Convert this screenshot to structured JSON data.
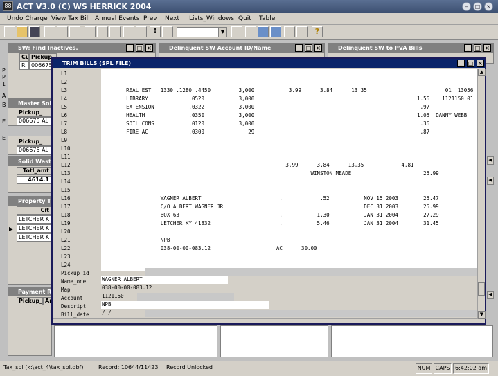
{
  "app": {
    "title": "ACT V3.0 (C) WS HERRICK 2004",
    "icon_label": "88"
  },
  "menu": [
    "Undo Charge",
    "View Tax Bill",
    "Annual Events",
    "Prev",
    "Next",
    "Lists_Windows",
    "Quit",
    "Table"
  ],
  "toolbar": {
    "icons": [
      "new-icon",
      "open-icon",
      "save-icon",
      "print-icon",
      "preview-icon",
      "spellcheck-icon",
      "cut-icon",
      "copy-icon",
      "paste-icon",
      "undo-icon",
      "redo-icon",
      "exclaim-icon",
      "edit-icon",
      "combo",
      "form-icon",
      "browse-icon",
      "locate-icon",
      "find-icon",
      "report-icon",
      "label-icon",
      "help-icon"
    ],
    "help_label": "?"
  },
  "bg_windows": {
    "find_inactives": {
      "title": "SW: Find Inactives.",
      "cols": [
        "Cu",
        "Pickup_"
      ],
      "row": [
        "R",
        "006675"
      ]
    },
    "delinq_sw": {
      "title": "Delinquent SW Account ID/Name"
    },
    "delinq_pva": {
      "title": "Delinquent SW to PVA Bills"
    },
    "master_sol": {
      "title": "Master Soli",
      "col": "Pickup_",
      "row": "006675 AL"
    },
    "extra": {
      "col": "Pickup_",
      "row": "006675 AL"
    },
    "solid_waste": {
      "title": "Solid Waste",
      "col": "Totl_amt",
      "row": "4614.1"
    },
    "property_tax": {
      "title": "Property Ta",
      "col": "Cit",
      "rows": [
        "LETCHER K",
        "LETCHER K",
        "LETCHER K"
      ]
    },
    "payment": {
      "title": "Payment Re",
      "col": "Pickup_id",
      "col2": "Ar"
    }
  },
  "left_markers": [
    "P",
    "P",
    "1",
    "A",
    "B",
    "E",
    "E"
  ],
  "trim": {
    "title": "TRIM BILLS (SPL FILE)",
    "line_labels": [
      "L1",
      "L2",
      "L3",
      "L4",
      "L5",
      "L6",
      "L7",
      "L8",
      "L9",
      "L10",
      "L11",
      "L12",
      "L13",
      "L14",
      "L15",
      "L16",
      "L17",
      "L18",
      "L19",
      "L20",
      "L21",
      "L22",
      "L23",
      "L24"
    ],
    "lines": [
      "",
      "",
      "        REAL EST  .1330 .1280 .4450         3,000           3.99      3.84      13.35                         01  13056",
      "        LIBRARY             .0520           3,000                                                    1.56    1121150 01",
      "        EXTENSION           .0322           3,000                                                     .97",
      "        HEALTH              .0350           3,000                                                    1.05  DANNY WEBB",
      "        SOIL CONS           .0120           3,000                                                     .36",
      "        FIRE AC             .0300              29                                                     .87",
      "",
      "",
      "",
      "                                                           3.99      3.84      13.35            4.81",
      "                                                                   WINSTON MEADE                       25.99",
      "",
      "",
      "                   WAGNER ALBERT                         .            .52           NOV 15 2003        25.47",
      "                   C/O ALBERT WAGNER JR                                             DEC 31 2003        25.99",
      "                   BOX 63                                .           1.30           JAN 31 2004        27.29",
      "                   LETCHER KY 41832                      .           5.46           JAN 31 2004        31.45",
      "",
      "                   NPB",
      "                   038-00-00-083.12                     AC      30.00",
      "",
      ""
    ],
    "fields": [
      {
        "label": "Pickup_id",
        "value": ""
      },
      {
        "label": "Name_one",
        "value": "WAGNER ALBERT"
      },
      {
        "label": "Map",
        "value": "038-00-00-083.12"
      },
      {
        "label": "Account",
        "value": "1121150"
      },
      {
        "label": "Descript",
        "value": "NPB"
      },
      {
        "label": "Bill_date",
        "value": "/  /"
      }
    ]
  },
  "status": {
    "table": "Tax_spl (k:\\act_4\\tax_spl.dbf)",
    "record": "Record: 10644/11423",
    "lock": "Record Unlocked",
    "num": "NUM",
    "caps": "CAPS",
    "time": "6:42:02 am"
  }
}
